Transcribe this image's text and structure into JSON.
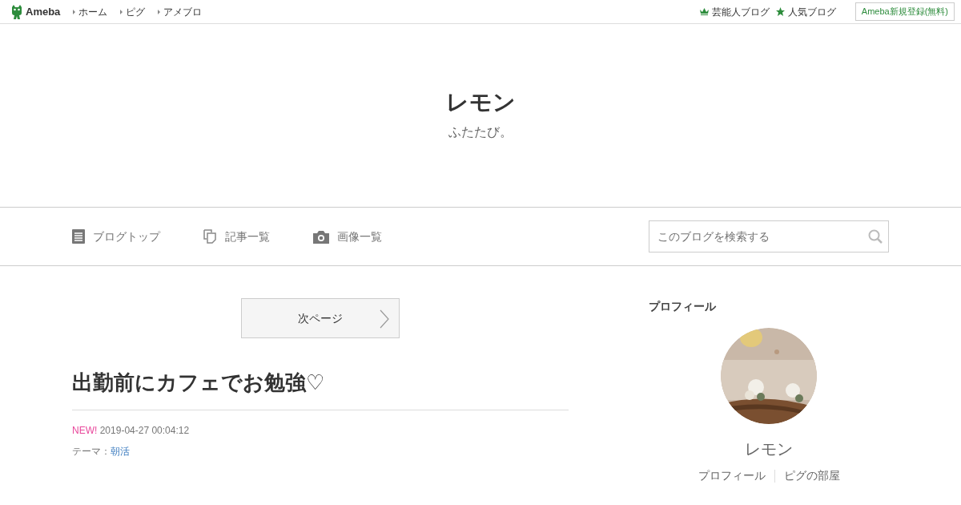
{
  "topbar": {
    "logo": "Ameba",
    "links": [
      "ホーム",
      "ピグ",
      "アメブロ"
    ],
    "right_links": [
      {
        "kind": "crown",
        "label": "芸能人ブログ"
      },
      {
        "kind": "star",
        "label": "人気ブログ"
      }
    ],
    "signup": "Ameba新規登録(無料)"
  },
  "header": {
    "title": "レモン",
    "subtitle": "ふたたび。"
  },
  "nav": {
    "items": [
      {
        "kind": "doc",
        "label": "ブログトップ"
      },
      {
        "kind": "copy",
        "label": "記事一覧"
      },
      {
        "kind": "camera",
        "label": "画像一覧"
      }
    ],
    "search": {
      "placeholder": "このブログを検索する"
    }
  },
  "pager": {
    "next": "次ページ"
  },
  "article": {
    "title": "出勤前にカフェでお勉強♡",
    "new_badge": "NEW!",
    "date": "2019-04-27 00:04:12",
    "theme_label": "テーマ：",
    "theme": "朝活"
  },
  "profile": {
    "heading": "プロフィール",
    "avatar": {
      "kind": "picture"
    },
    "name": "レモン",
    "links": [
      "プロフィール",
      "ピグの部屋"
    ]
  }
}
